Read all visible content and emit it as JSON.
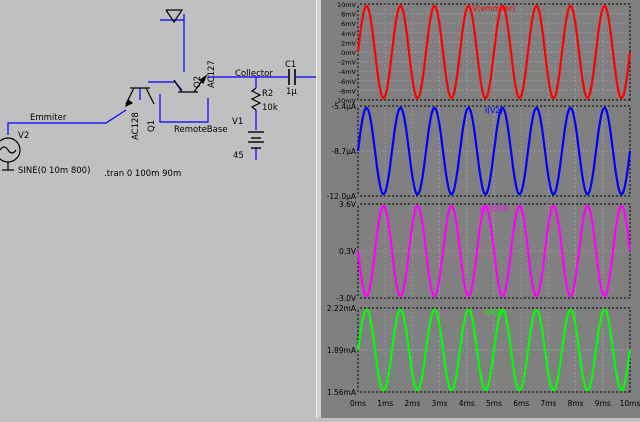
{
  "schematic": {
    "labels": {
      "emmiter_net": "Emmiter",
      "v2_name": "V2",
      "v2_value": "SINE(0 10m 800)",
      "tran_directive": ".tran 0 100m 90m",
      "q1_name": "Q1",
      "q1_model": "AC128",
      "q2_name": "Q2",
      "q2_model": "AC127",
      "remotebase_net": "RemoteBase",
      "collector_net": "Collector",
      "c1_name": "C1",
      "c1_value": "1μ",
      "r2_name": "R2",
      "r2_value": "10k",
      "v1_name": "V1",
      "v1_value": "45"
    },
    "colors": {
      "wire": "#0000ff",
      "component": "#000000",
      "background": "#c0c0c0"
    }
  },
  "waveforms": {
    "x_ticks": [
      "0ms",
      "1ms",
      "2ms",
      "3ms",
      "4ms",
      "5ms",
      "6ms",
      "7ms",
      "8ms",
      "9ms",
      "10ms"
    ],
    "panes": [
      {
        "title": "V(emmiter)",
        "color": "#ff0000",
        "y_ticks": [
          "10mV",
          "8mV",
          "6mV",
          "4mV",
          "2mV",
          "0mV",
          "-2mV",
          "-4mV",
          "-6mV",
          "-8mV",
          "-10mV"
        ]
      },
      {
        "title": "I(V2)",
        "color": "#0000ff",
        "y_ticks": [
          "-5.4μA",
          "-8.7μA",
          "-12.0μA"
        ]
      },
      {
        "title": "V(n003)",
        "color": "#ff00ff",
        "y_ticks": [
          "3.6V",
          "0.3V",
          "-3.0V"
        ]
      },
      {
        "title": "I(R2)",
        "color": "#00ff00",
        "y_ticks": [
          "2.22mA",
          "1.89mA",
          "1.56mA"
        ]
      }
    ],
    "chart_data": {
      "type": "line",
      "xlabel": "",
      "x_unit": "ms",
      "xlim": [
        0,
        10
      ],
      "signal": "sine",
      "frequency_hz": 800,
      "series": [
        {
          "name": "V(emmiter)",
          "amplitude": 0.01,
          "offset": 0,
          "ylim": [
            -0.01,
            0.01
          ],
          "unit": "V",
          "phase": "sine"
        },
        {
          "name": "I(V2)",
          "amplitude": 3.3e-06,
          "offset": -8.7e-06,
          "ylim": [
            -1.2e-05,
            -5.4e-06
          ],
          "unit": "A",
          "phase": "sine"
        },
        {
          "name": "V(n003)",
          "amplitude": 3.3,
          "offset": 0.3,
          "ylim": [
            -3.0,
            3.6
          ],
          "unit": "V",
          "phase": "inverted"
        },
        {
          "name": "I(R2)",
          "amplitude": 0.00033,
          "offset": 0.00189,
          "ylim": [
            0.00156,
            0.00222
          ],
          "unit": "A",
          "phase": "sine"
        }
      ]
    }
  }
}
